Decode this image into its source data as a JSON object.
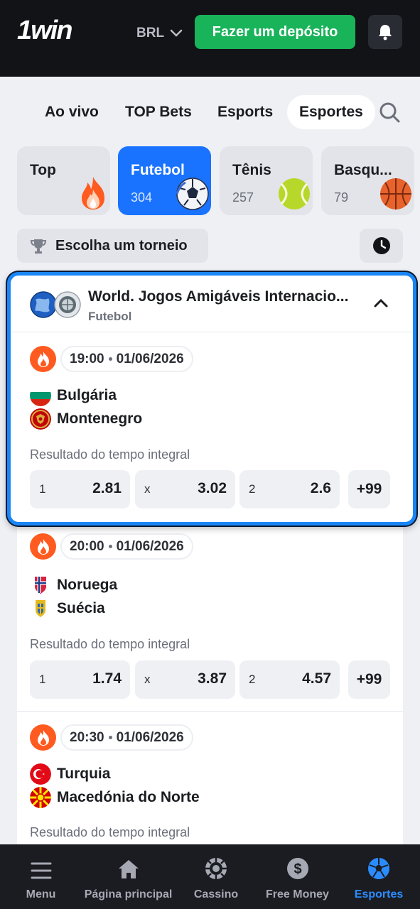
{
  "header": {
    "logo": "1win",
    "currency": "BRL",
    "deposit_label": "Fazer um depósito"
  },
  "tabs": [
    {
      "label": "Ao vivo"
    },
    {
      "label": "TOP Bets"
    },
    {
      "label": "Esports"
    },
    {
      "label": "Esportes",
      "active": true
    }
  ],
  "sports": [
    {
      "name": "Top",
      "count": "",
      "icon": "fire-icon"
    },
    {
      "name": "Futebol",
      "count": "304",
      "icon": "soccer-ball-icon",
      "active": true
    },
    {
      "name": "Tênis",
      "count": "257",
      "icon": "tennis-ball-icon"
    },
    {
      "name": "Basqu...",
      "count": "79",
      "icon": "basketball-icon"
    }
  ],
  "filter": {
    "tournament_label": "Escolha um torneio"
  },
  "tournament": {
    "title": "World. Jogos Amigáveis Internacio...",
    "sport": "Futebol"
  },
  "matches": [
    {
      "time": "19:00",
      "date": "01/06/2026",
      "team1": "Bulgária",
      "team2": "Montenegro",
      "market": "Resultado do tempo integral",
      "odds": [
        {
          "label": "1",
          "value": "2.81"
        },
        {
          "label": "x",
          "value": "3.02"
        },
        {
          "label": "2",
          "value": "2.6"
        }
      ],
      "more": "+99"
    },
    {
      "time": "20:00",
      "date": "01/06/2026",
      "team1": "Noruega",
      "team2": "Suécia",
      "market": "Resultado do tempo integral",
      "odds": [
        {
          "label": "1",
          "value": "1.74"
        },
        {
          "label": "x",
          "value": "3.87"
        },
        {
          "label": "2",
          "value": "4.57"
        }
      ],
      "more": "+99"
    },
    {
      "time": "20:30",
      "date": "01/06/2026",
      "team1": "Turquia",
      "team2": "Macedónia do Norte",
      "market": "Resultado do tempo integral"
    }
  ],
  "bottom_nav": [
    {
      "label": "Menu",
      "icon": "menu-icon"
    },
    {
      "label": "Página principal",
      "icon": "home-icon"
    },
    {
      "label": "Cassino",
      "icon": "casino-chip-icon"
    },
    {
      "label": "Free Money",
      "icon": "dollar-coin-icon"
    },
    {
      "label": "Esportes",
      "icon": "soccer-icon",
      "active": true
    }
  ],
  "colors": {
    "accent": "#1a73ff",
    "deposit": "#19b35a",
    "fire": "#ff5a1f",
    "highlight_border": "#1a86f5"
  }
}
